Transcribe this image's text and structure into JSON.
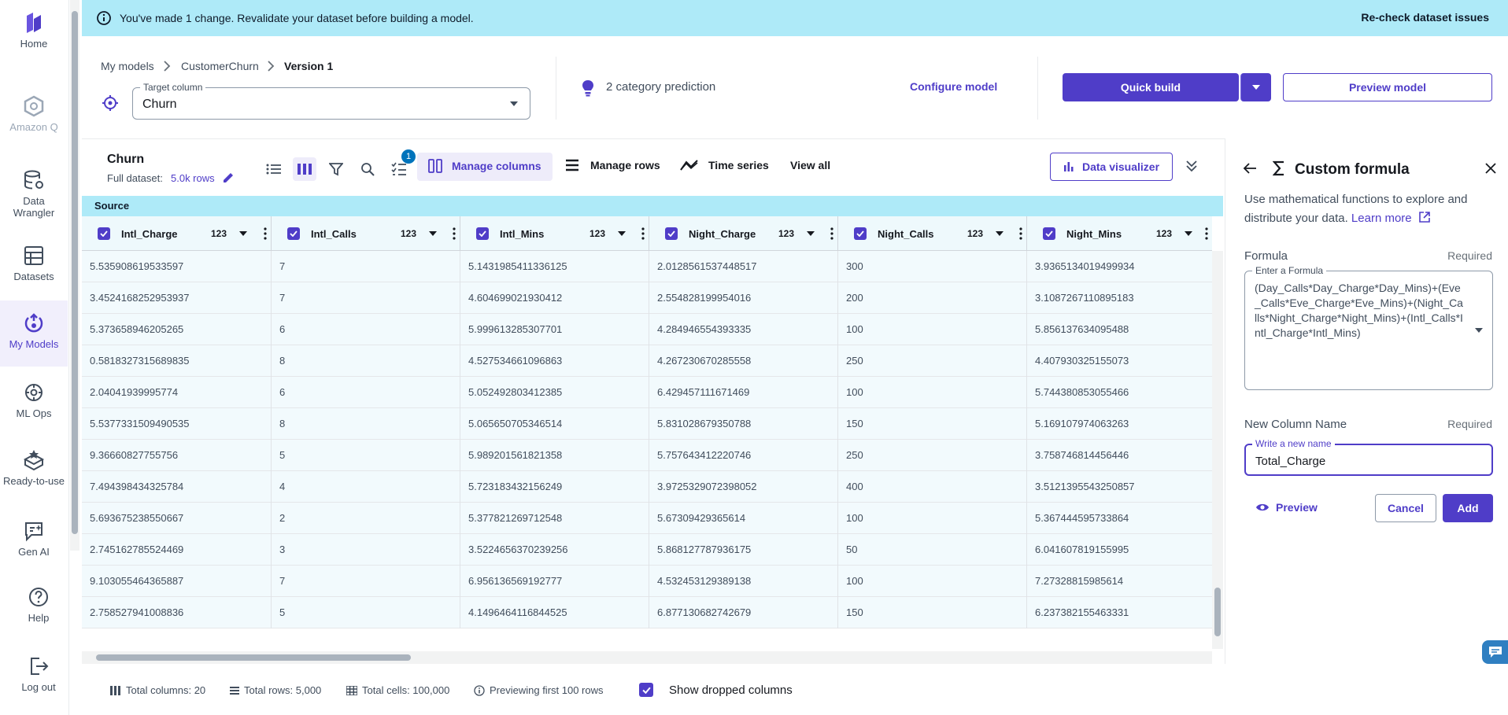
{
  "nav": {
    "items": [
      {
        "label": "Home",
        "state": "normal"
      },
      {
        "label": "Amazon Q",
        "state": "disabled"
      },
      {
        "label": "Data Wrangler",
        "state": "normal"
      },
      {
        "label": "Datasets",
        "state": "normal"
      },
      {
        "label": "My Models",
        "state": "active"
      },
      {
        "label": "ML Ops",
        "state": "normal"
      },
      {
        "label": "Ready-to-use",
        "state": "normal"
      },
      {
        "label": "Gen AI",
        "state": "normal"
      },
      {
        "label": "Help",
        "state": "normal"
      },
      {
        "label": "Log out",
        "state": "normal"
      }
    ]
  },
  "banner": {
    "message": "You've made 1 change. Revalidate your dataset before building a model.",
    "action": "Re-check dataset issues"
  },
  "breadcrumb": {
    "items": [
      "My models",
      "CustomerChurn",
      "Version 1"
    ]
  },
  "target": {
    "label": "Target column",
    "value": "Churn"
  },
  "prediction": {
    "text": "2 category prediction"
  },
  "header_actions": {
    "configure": "Configure model",
    "quick_build": "Quick build",
    "preview_model": "Preview model"
  },
  "dataset": {
    "name": "Churn",
    "full_label": "Full dataset:",
    "rows": "5.0k rows"
  },
  "toolbar": {
    "badge": "1",
    "manage_columns": "Manage columns",
    "manage_rows": "Manage rows",
    "time_series": "Time series",
    "view_all": "View all",
    "data_visualizer": "Data visualizer"
  },
  "grid": {
    "group_label": "Source",
    "type_label": "123",
    "columns": [
      "Intl_Charge",
      "Intl_Calls",
      "Intl_Mins",
      "Night_Charge",
      "Night_Calls",
      "Night_Mins"
    ],
    "rows": [
      [
        "5.535908619533597",
        "7",
        "5.1431985411336125",
        "2.0128561537448517",
        "300",
        "3.9365134019499934"
      ],
      [
        "3.4524168252953937",
        "7",
        "4.604699021930412",
        "2.554828199954016",
        "200",
        "3.1087267110895183"
      ],
      [
        "5.373658946205265",
        "6",
        "5.999613285307701",
        "4.284946554393335",
        "100",
        "5.856137634095488"
      ],
      [
        "0.5818327315689835",
        "8",
        "4.527534661096863",
        "4.267230670285558",
        "250",
        "4.407930325155073"
      ],
      [
        "2.04041939995774",
        "6",
        "5.052492803412385",
        "6.429457111671469",
        "100",
        "5.744380853055466"
      ],
      [
        "5.5377331509490535",
        "8",
        "5.065650705346514",
        "5.831028679350788",
        "150",
        "5.169107974063263"
      ],
      [
        "9.36660827755756",
        "5",
        "5.989201561821358",
        "5.757643412220746",
        "250",
        "3.758746814456446"
      ],
      [
        "7.494398434325784",
        "4",
        "5.723183432156249",
        "3.9725329072398052",
        "400",
        "3.5121395543250857"
      ],
      [
        "5.693675238550667",
        "2",
        "5.377821269712548",
        "5.67309429365614",
        "100",
        "5.367444595733864"
      ],
      [
        "2.745162785524469",
        "3",
        "3.5224656370239256",
        "5.868127787936175",
        "50",
        "6.041607819155995"
      ],
      [
        "9.103055464365887",
        "7",
        "6.956136569192777",
        "4.532453129389138",
        "100",
        "7.27328815985614"
      ],
      [
        "2.758527941008836",
        "5",
        "4.1496464116844525",
        "6.877130682742679",
        "150",
        "6.237382155463331"
      ]
    ]
  },
  "footer": {
    "total_columns": "Total columns: 20",
    "total_rows": "Total rows: 5,000",
    "total_cells": "Total cells: 100,000",
    "previewing": "Previewing first 100 rows",
    "show_dropped": "Show dropped columns"
  },
  "panel": {
    "title": "Custom formula",
    "description": "Use mathematical functions to explore and distribute your data.",
    "learn_more": "Learn more",
    "formula_label": "Formula",
    "required": "Required",
    "formula_placeholder_label": "Enter a Formula",
    "formula_value": "(Day_Calls*Day_Charge*Day_Mins)+(Eve_Calls*Eve_Charge*Eve_Mins)+(Night_Calls*Night_Charge*Night_Mins)+(Intl_Calls*Intl_Charge*Intl_Mins)",
    "name_label": "New Column Name",
    "name_placeholder_label": "Write a new name",
    "name_value": "Total_Charge",
    "preview": "Preview",
    "cancel": "Cancel",
    "add": "Add"
  },
  "colors": {
    "brand": "#4f3dc8",
    "banner": "#aeeaf8",
    "source_bar": "#aeeaf8"
  }
}
